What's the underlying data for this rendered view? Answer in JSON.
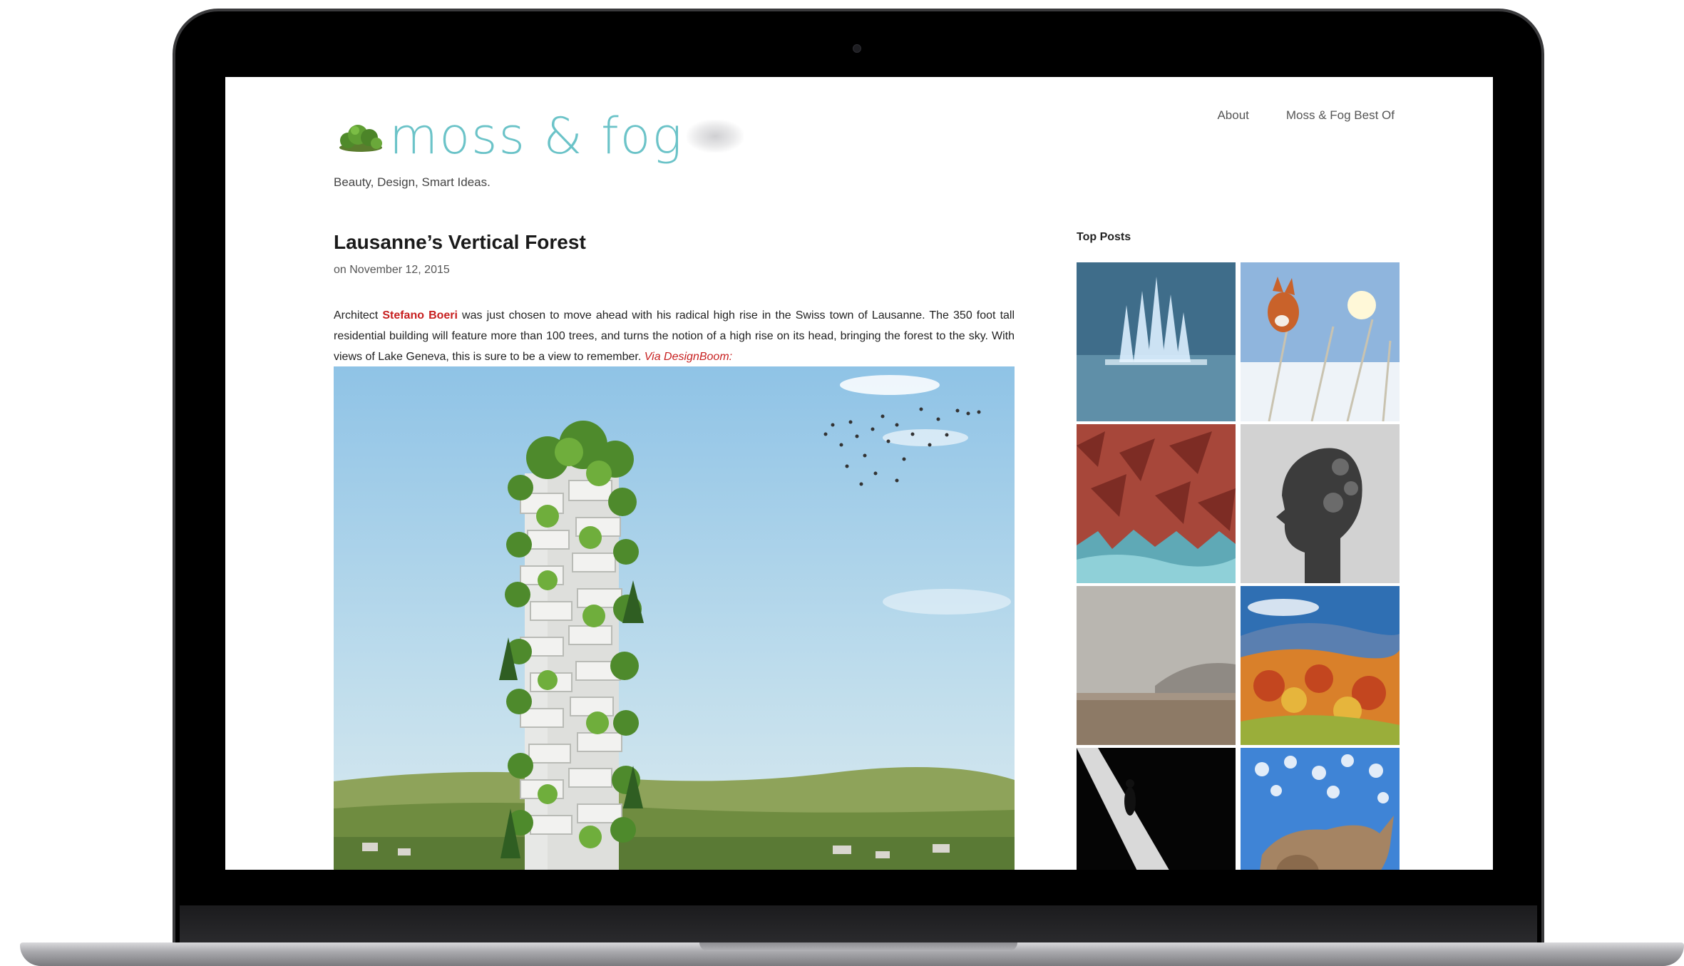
{
  "site": {
    "logo_text": "moss & fog",
    "tagline": "Beauty, Design, Smart Ideas."
  },
  "nav": {
    "items": [
      {
        "label": "About"
      },
      {
        "label": "Moss & Fog Best Of"
      }
    ]
  },
  "post": {
    "title": "Lausanne’s Vertical Forest",
    "date": "on November 12, 2015",
    "body_intro": "Architect ",
    "architect_link": "Stefano Boeri",
    "body_text": " was just chosen to move ahead with his radical high rise in the Swiss town of Lausanne. The 350 foot tall residential building will feature more than 100 trees, and turns the notion of a high rise on its head, bringing the forest to the sky. With views of Lake Geneva, this is sure to be a view to remember. ",
    "via_link": "Via DesignBoom:"
  },
  "sidebar": {
    "title": "Top Posts",
    "thumbnails": [
      {
        "icon": "ice-crystal-thumbnail"
      },
      {
        "icon": "fox-in-snow-thumbnail"
      },
      {
        "icon": "red-dunes-thumbnail"
      },
      {
        "icon": "double-exposure-profile-thumbnail"
      },
      {
        "icon": "foggy-beach-thumbnail"
      },
      {
        "icon": "autumn-valley-thumbnail"
      },
      {
        "icon": "road-shadow-thumbnail"
      },
      {
        "icon": "rhino-sky-thumbnail"
      }
    ]
  },
  "colors": {
    "logo": "#6bc3c8",
    "link": "#c71f1f",
    "laptop_frame": "#000000"
  }
}
